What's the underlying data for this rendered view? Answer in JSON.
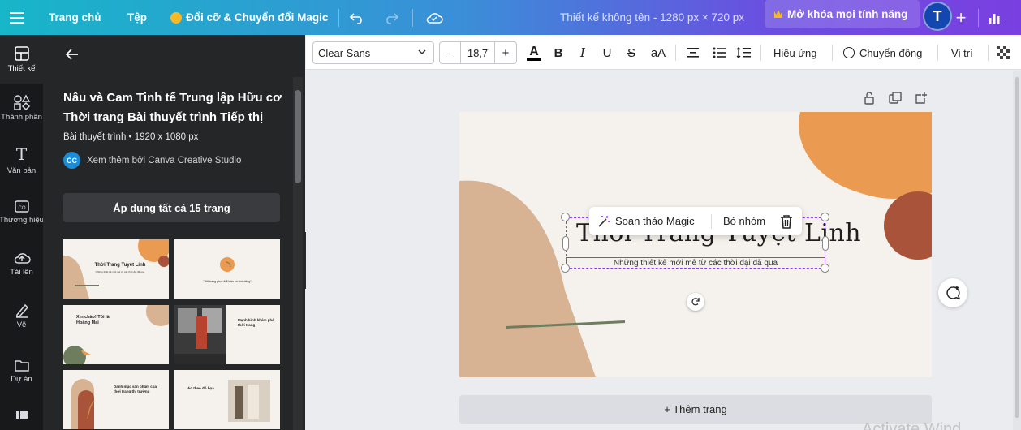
{
  "topbar": {
    "home": "Trang chủ",
    "file": "Tệp",
    "magic": "Đổi cỡ & Chuyển đổi Magic",
    "doc_title": "Thiết kế không tên - 1280 px × 720 px",
    "unlock": "Mở khóa mọi tính năng",
    "avatar_letter": "T"
  },
  "rail": [
    {
      "label": "Thiết kế"
    },
    {
      "label": "Thành phần"
    },
    {
      "label": "Văn bản"
    },
    {
      "label": "Thương hiệu"
    },
    {
      "label": "Tải lên"
    },
    {
      "label": "Vẽ"
    },
    {
      "label": "Dự án"
    }
  ],
  "panel": {
    "title": "Nâu và Cam Tinh tế Trung lập Hữu cơ Thời trang Bài thuyết trình Tiếp thị",
    "meta": "Bài thuyết trình • 1920 x 1080 px",
    "creator_badge": "CC",
    "creator": "Xem thêm bởi Canva Creative Studio",
    "apply": "Áp dụng tất cả 15 trang",
    "thumbs": [
      {
        "title": "Thời Trang Tuyệt Linh",
        "sub": "Những thiết kế mới mẻ từ các thời đại đã qua"
      },
      {
        "title": "\"Bởi trang phục thể hiện cá tính riêng\"",
        "sub": ""
      },
      {
        "title": "Xin chào! Tôi là Hoàng Mai",
        "sub": ""
      },
      {
        "title": "Mạnh bình khám phá thời trang",
        "sub": ""
      },
      {
        "title": "Danh mục sản phẩm của thời trang thị trường",
        "sub": ""
      },
      {
        "title": "Áo theo đồ họa",
        "sub": ""
      }
    ]
  },
  "toolbar": {
    "font": "Clear Sans",
    "size": "18,7",
    "minus": "–",
    "plus": "+",
    "effects": "Hiệu ứng",
    "animate": "Chuyển động",
    "position": "Vị trí",
    "text_color_hex": "#000000"
  },
  "canvas": {
    "title": "Thời Trang Tuyệt Linh",
    "subtitle": "Những thiết kế mới mẻ từ các thời đại đã qua",
    "ctx_magic": "Soạn thảo Magic",
    "ctx_ungroup": "Bỏ nhóm",
    "add_page": "+ Thêm trang",
    "watermark": "Activate Wind"
  },
  "colors": {
    "accent": "#8b3dff",
    "shape_orange": "#eb9a52",
    "shape_rust": "#a9533a",
    "shape_tan": "#d7b293",
    "shape_green": "#6d7d5e",
    "slide_bg": "#f5f1ec"
  }
}
